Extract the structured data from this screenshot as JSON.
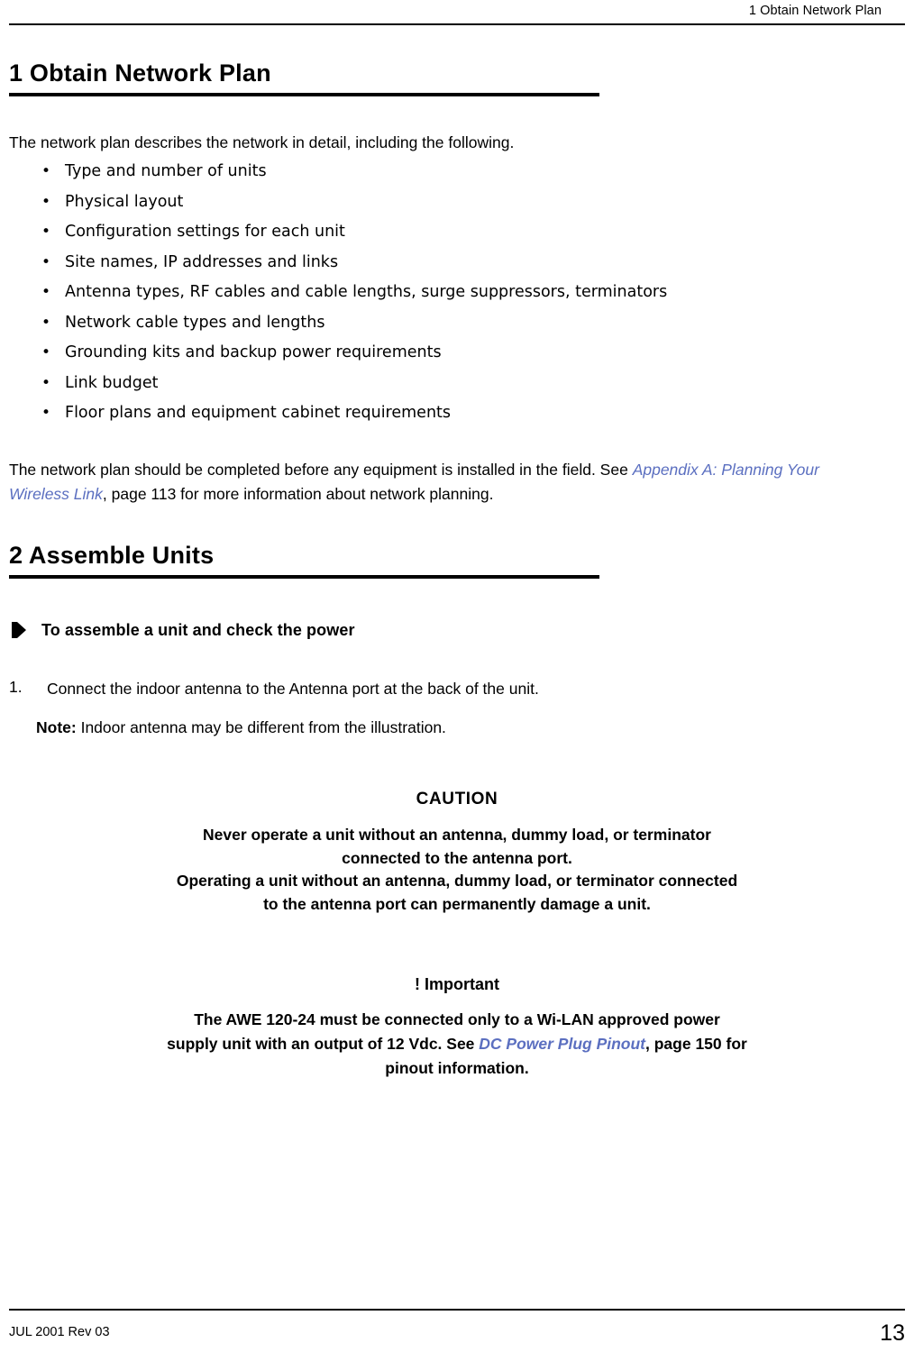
{
  "header": {
    "running_head": "1 Obtain Network Plan"
  },
  "section1": {
    "title": "1 Obtain Network Plan",
    "intro": "The network plan describes the network in detail, including the following.",
    "bullet_marker": "•",
    "bullets": [
      "Type and number of units",
      "Physical layout",
      "Configuration settings for each unit",
      "Site names, IP addresses and links",
      "Antenna types, RF cables and cable lengths, surge suppressors, terminators",
      "Network cable types and lengths",
      "Grounding kits and backup power requirements",
      "Link budget",
      "Floor plans and equipment cabinet requirements"
    ],
    "after_lead": "The network plan should be completed before any equipment is installed in the field. See ",
    "after_xref": "Appendix A: Planning Your Wireless Link",
    "after_tail": ", page 113 for more information about network planning."
  },
  "section2": {
    "title": "2 Assemble Units",
    "procedure_title": "To assemble a unit and check the power",
    "step_number": "1.",
    "step_text": "Connect the indoor antenna to the Antenna port at the back of the unit.",
    "note_label": "Note:",
    "note_text": " Indoor antenna may be different from the illustration."
  },
  "caution": {
    "title": "CAUTION",
    "line1": "Never operate a unit without an antenna, dummy load, or terminator",
    "line2": "connected to the antenna port.",
    "line3": "Operating a unit without an antenna, dummy load, or terminator connected",
    "line4": "to the antenna port can permanently damage a unit."
  },
  "important": {
    "title": "! Important",
    "line1": "The AWE 120-24 must be connected only to a Wi-LAN approved power",
    "line2_pre": "supply unit with an output of 12 Vdc. See ",
    "line2_xref": "DC Power Plug Pinout",
    "line2_post": ", page 150 for",
    "line3": "pinout information."
  },
  "footer": {
    "left": "JUL 2001 Rev 03",
    "page_number": "13"
  },
  "colors": {
    "xref": "#5b6fc0",
    "rule": "#000000"
  }
}
